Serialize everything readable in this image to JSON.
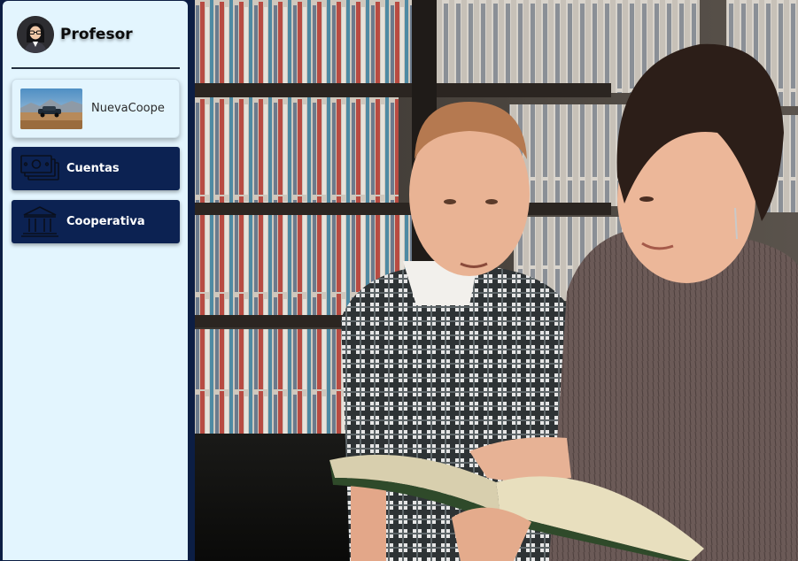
{
  "sidebar": {
    "profile": {
      "name": "Profesor",
      "avatar_icon": "teacher-avatar-icon"
    },
    "cooperative": {
      "name": "NuevaCoope",
      "thumbnail": "car-landscape-image"
    },
    "nav": [
      {
        "label": "Cuentas",
        "icon": "money-bills-icon"
      },
      {
        "label": "Cooperativa",
        "icon": "bank-building-icon"
      }
    ]
  },
  "main": {
    "hero_image": "teacher-reading-to-boy-library-photo"
  },
  "colors": {
    "sidebar_bg": "#e3f5fe",
    "nav_button_bg": "#0c2252",
    "page_bg": "#0c1e44",
    "nav_text": "#ffffff"
  }
}
